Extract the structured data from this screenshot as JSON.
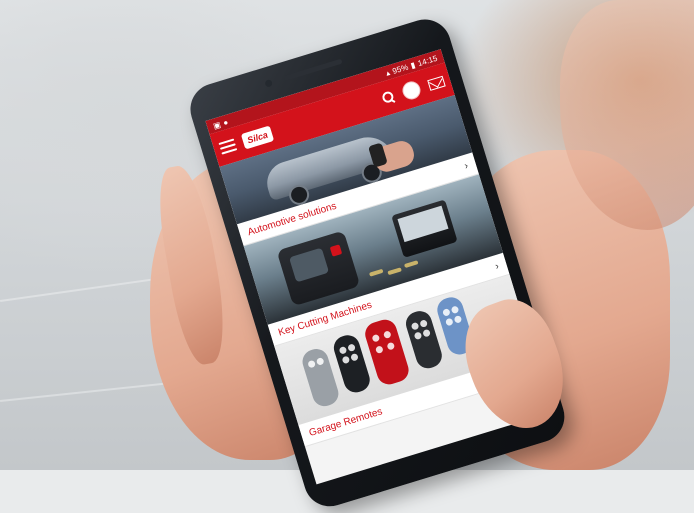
{
  "status_bar": {
    "battery": "95%",
    "time": "14:15"
  },
  "app_bar": {
    "logo_text": "Silca"
  },
  "sections": [
    {
      "title": "Automotive solutions",
      "arrow": "›"
    },
    {
      "title": "Key Cutting Machines",
      "arrow": "›"
    },
    {
      "title": "Garage Remotes",
      "arrow": "›"
    }
  ],
  "colors": {
    "brand_red": "#d3121b",
    "phone_body": "#15181c"
  },
  "icons": [
    "hamburger-menu-icon",
    "search-icon",
    "avatar-icon",
    "mail-icon",
    "chevron-right-icon"
  ]
}
